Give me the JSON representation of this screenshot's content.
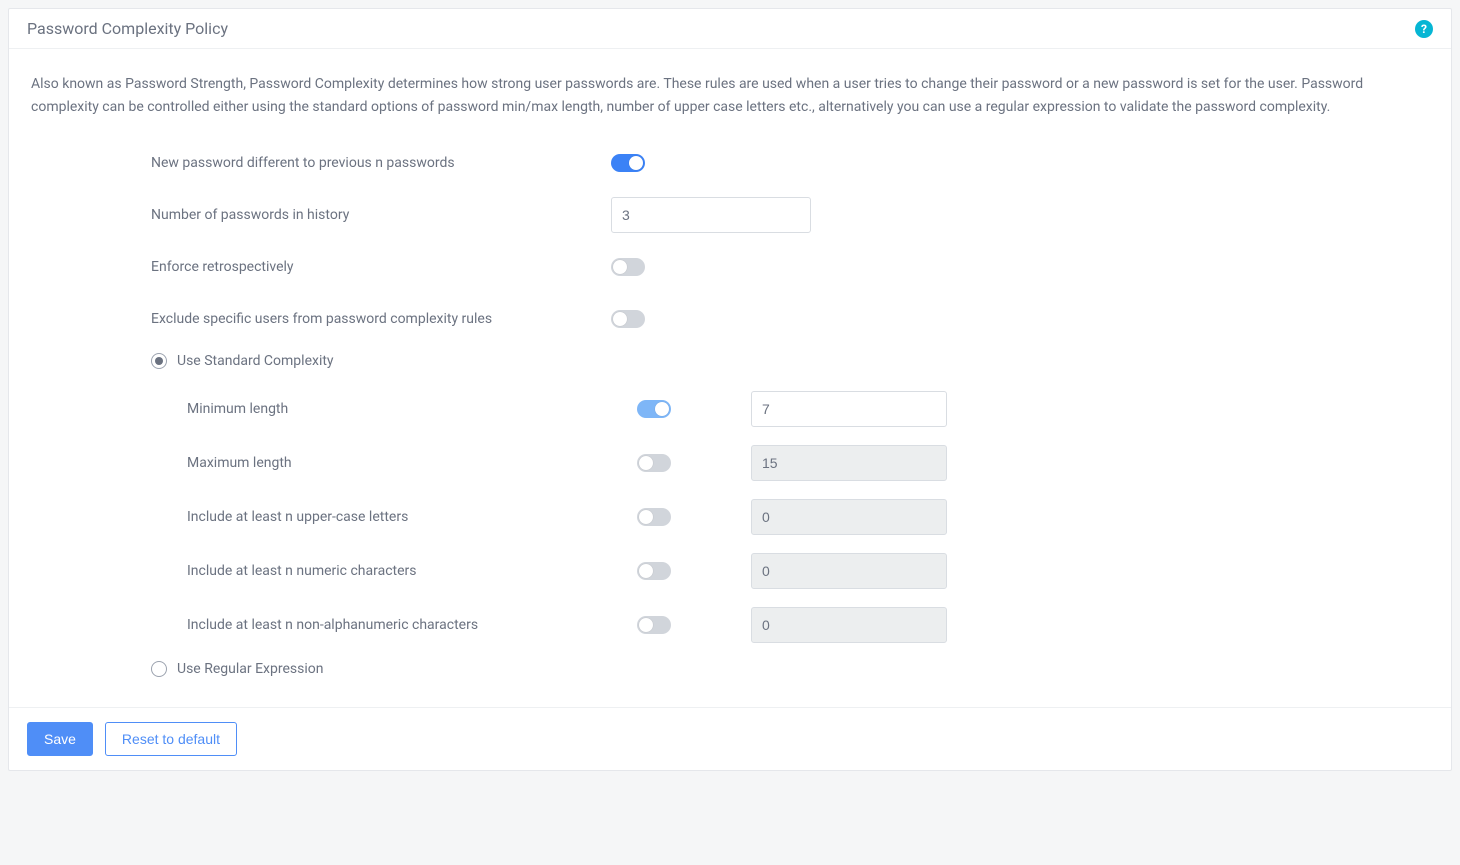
{
  "header": {
    "title": "Password Complexity Policy"
  },
  "description": "Also known as Password Strength, Password Complexity determines how strong user passwords are. These rules are used when a user tries to change their password or a new password is set for the user. Password complexity can be controlled either using the standard options of password min/max length, number of upper case letters etc., alternatively you can use a regular expression to validate the password complexity.",
  "fields": {
    "diff_prev": {
      "label": "New password different to previous n passwords",
      "on": true
    },
    "history_count": {
      "label": "Number of passwords in history",
      "value": "3"
    },
    "enforce_retro": {
      "label": "Enforce retrospectively",
      "on": false
    },
    "exclude_users": {
      "label": "Exclude specific users from password complexity rules",
      "on": false
    }
  },
  "mode": {
    "standard_label": "Use Standard Complexity",
    "regex_label": "Use Regular Expression",
    "selected": "standard"
  },
  "standard": {
    "min_len": {
      "label": "Minimum length",
      "on": true,
      "value": "7"
    },
    "max_len": {
      "label": "Maximum length",
      "on": false,
      "value": "15"
    },
    "upper": {
      "label": "Include at least n upper-case letters",
      "on": false,
      "value": "0"
    },
    "numeric": {
      "label": "Include at least n numeric characters",
      "on": false,
      "value": "0"
    },
    "nonalnum": {
      "label": "Include at least n non-alphanumeric characters",
      "on": false,
      "value": "0"
    }
  },
  "footer": {
    "save": "Save",
    "reset": "Reset to default"
  }
}
